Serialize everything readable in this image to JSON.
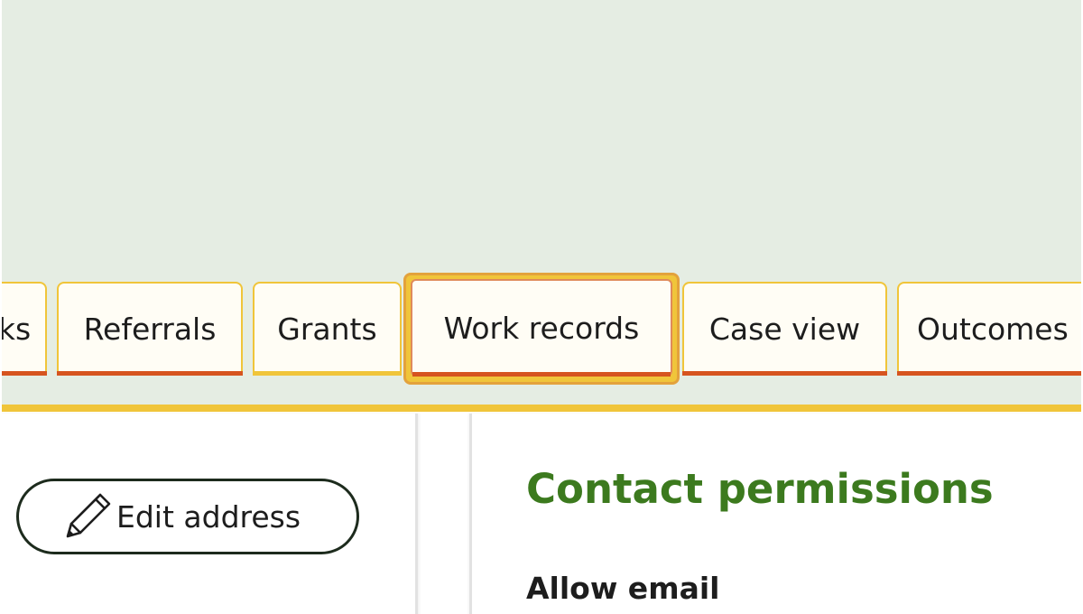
{
  "tabs": [
    {
      "label": "ks"
    },
    {
      "label": "Referrals"
    },
    {
      "label": "Grants"
    },
    {
      "label": "Work records",
      "active": true
    },
    {
      "label": "Case view"
    },
    {
      "label": "Outcomes"
    }
  ],
  "left_panel": {
    "edit_button_label": "Edit address"
  },
  "right_panel": {
    "heading": "Contact permissions",
    "subheading": "Allow email"
  },
  "colors": {
    "header_bg": "#e5ede3",
    "accent_yellow": "#f0c53a",
    "accent_orange": "#d6541f",
    "focus_ring": "#e3a23c",
    "heading_green": "#3c7a1e"
  }
}
